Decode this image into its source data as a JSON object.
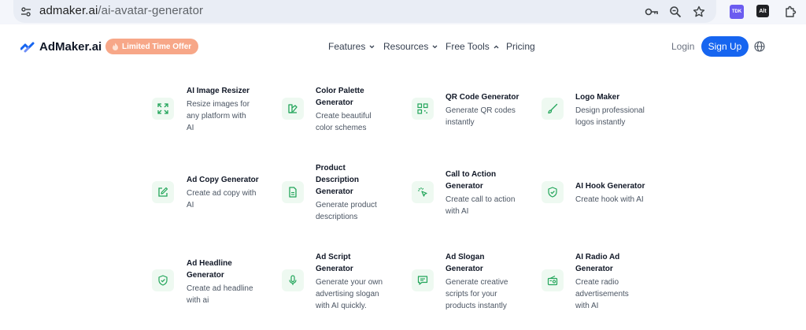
{
  "browser": {
    "url_host": "admaker.ai",
    "url_path": "/ai-avatar-generator",
    "extensions": {
      "tdk": "TDK",
      "alt": "Alt"
    }
  },
  "header": {
    "brand": "AdMaker.ai",
    "offer": "Limited Time Offer",
    "nav": [
      "Features",
      "Resources",
      "Free Tools",
      "Pricing"
    ],
    "login": "Login",
    "signup": "Sign Up"
  },
  "tools": [
    {
      "title": "AI Image Resizer",
      "desc": "Resize images for\nany platform with\nAI",
      "icon": "resize-icon"
    },
    {
      "title": "Color Palette\nGenerator",
      "desc": "Create beautiful\ncolor schemes",
      "icon": "palette-icon"
    },
    {
      "title": "QR Code Generator",
      "desc": "Generate QR codes\ninstantly",
      "icon": "qr-code-icon"
    },
    {
      "title": "Logo Maker",
      "desc": "Design professional\nlogos instantly",
      "icon": "brush-icon"
    },
    {
      "title": "Ad Copy Generator",
      "desc": "Create ad copy with\nAI",
      "icon": "edit-icon"
    },
    {
      "title": "Product\nDescription\nGenerator",
      "desc": "Generate product\ndescriptions",
      "icon": "document-icon"
    },
    {
      "title": "Call to Action\nGenerator",
      "desc": "Create call to action\nwith AI",
      "icon": "click-icon"
    },
    {
      "title": "AI Hook Generator",
      "desc": "Create hook with AI",
      "icon": "shield-check-icon"
    },
    {
      "title": "Ad Headline\nGenerator",
      "desc": "Create ad headline\nwith ai",
      "icon": "shield-check-icon"
    },
    {
      "title": "Ad Script\nGenerator",
      "desc": "Generate your own\nadvertising slogan\nwith AI quickly.",
      "icon": "microphone-icon"
    },
    {
      "title": "Ad Slogan\nGenerator",
      "desc": "Generate creative\nscripts for your\nproducts instantly",
      "icon": "message-icon"
    },
    {
      "title": "AI Radio Ad\nGenerator",
      "desc": "Create radio\nadvertisements\nwith AI",
      "icon": "radio-icon"
    }
  ],
  "colors": {
    "accent": "#1665f0",
    "tool_green": "#22a55a",
    "offer": "#f7a788"
  }
}
